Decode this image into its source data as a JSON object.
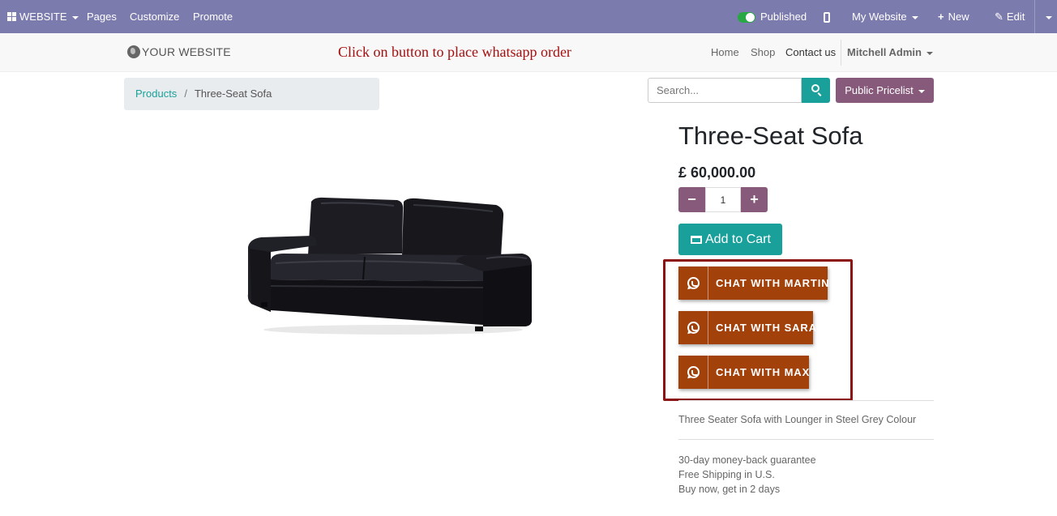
{
  "admin_bar": {
    "website_menu": "WEBSITE",
    "pages": "Pages",
    "customize": "Customize",
    "promote": "Promote",
    "published": "Published",
    "my_website": "My Website",
    "new": "New",
    "edit": "Edit"
  },
  "header": {
    "logo": "YOUR WEBSITE",
    "banner": "Click on button to place whatsapp order",
    "nav": [
      "Home",
      "Shop",
      "Contact us"
    ],
    "user": "Mitchell Admin"
  },
  "breadcrumb": {
    "parent": "Products",
    "separator": "/",
    "current": "Three-Seat Sofa"
  },
  "search": {
    "placeholder": "Search..."
  },
  "pricelist": "Public Pricelist",
  "product": {
    "name": "Three-Seat Sofa",
    "price": "£ 60,000.00",
    "quantity": "1",
    "minus": "−",
    "plus": "+",
    "add_to_cart": "Add to Cart",
    "whatsapp_buttons": [
      "CHAT WITH MARTIN",
      "CHAT WITH SARA",
      "CHAT WITH MAX"
    ],
    "description": "Three Seater Sofa with Lounger in Steel Grey Colour",
    "terms": [
      "30-day money-back guarantee",
      "Free Shipping in U.S.",
      "Buy now, get in 2 days"
    ]
  },
  "colors": {
    "admin_bar": "#7c7bad",
    "primary": "#875a7b",
    "teal": "#1aa09a",
    "whatsapp_button": "#a3410b",
    "highlight_border": "#8b1313",
    "banner_text": "#a30f0f"
  }
}
